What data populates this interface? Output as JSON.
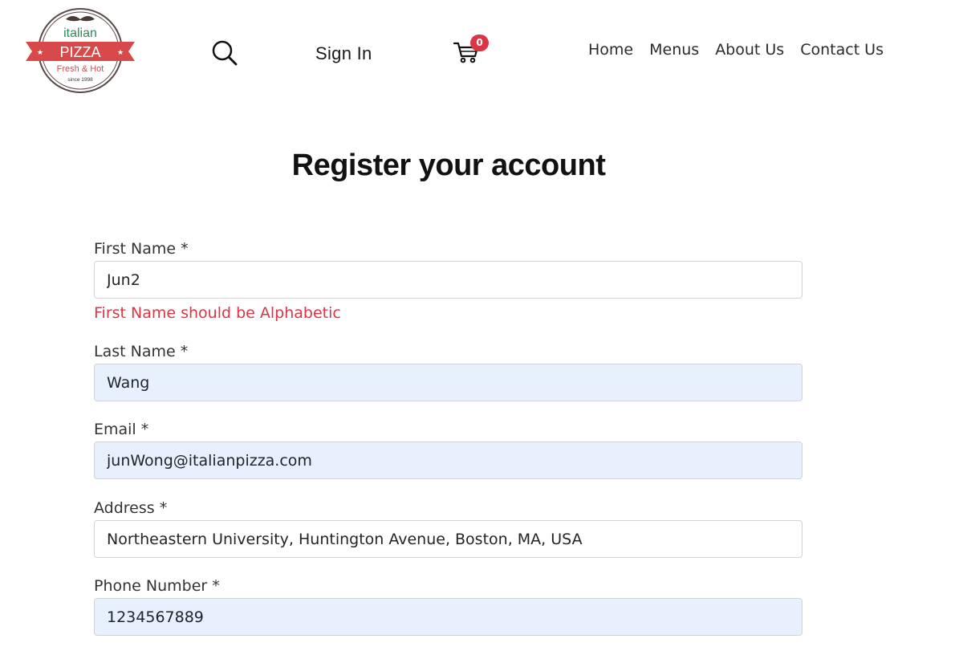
{
  "header": {
    "logo": {
      "line1": "italian",
      "line2": "PIZZA",
      "line3": "Fresh & Hot",
      "line4": "since 1998"
    },
    "signin_label": "Sign In",
    "cart_count": "0",
    "nav": [
      {
        "label": "Home"
      },
      {
        "label": "Menus"
      },
      {
        "label": "About Us"
      },
      {
        "label": "Contact Us"
      }
    ]
  },
  "page": {
    "title": "Register your account"
  },
  "form": {
    "first_name": {
      "label": "First Name *",
      "value": "Jun2",
      "error": "First Name should be Alphabetic"
    },
    "last_name": {
      "label": "Last Name *",
      "value": "Wang"
    },
    "email": {
      "label": "Email *",
      "value": "junWong@italianpizza.com"
    },
    "address": {
      "label": "Address *",
      "value": "Northeastern University, Huntington Avenue, Boston, MA, USA"
    },
    "phone": {
      "label": "Phone Number *",
      "value": "1234567889"
    }
  },
  "colors": {
    "brand_red": "#dc3545",
    "brand_green": "#2e8b57",
    "autofill_bg": "#e8f0fe"
  }
}
